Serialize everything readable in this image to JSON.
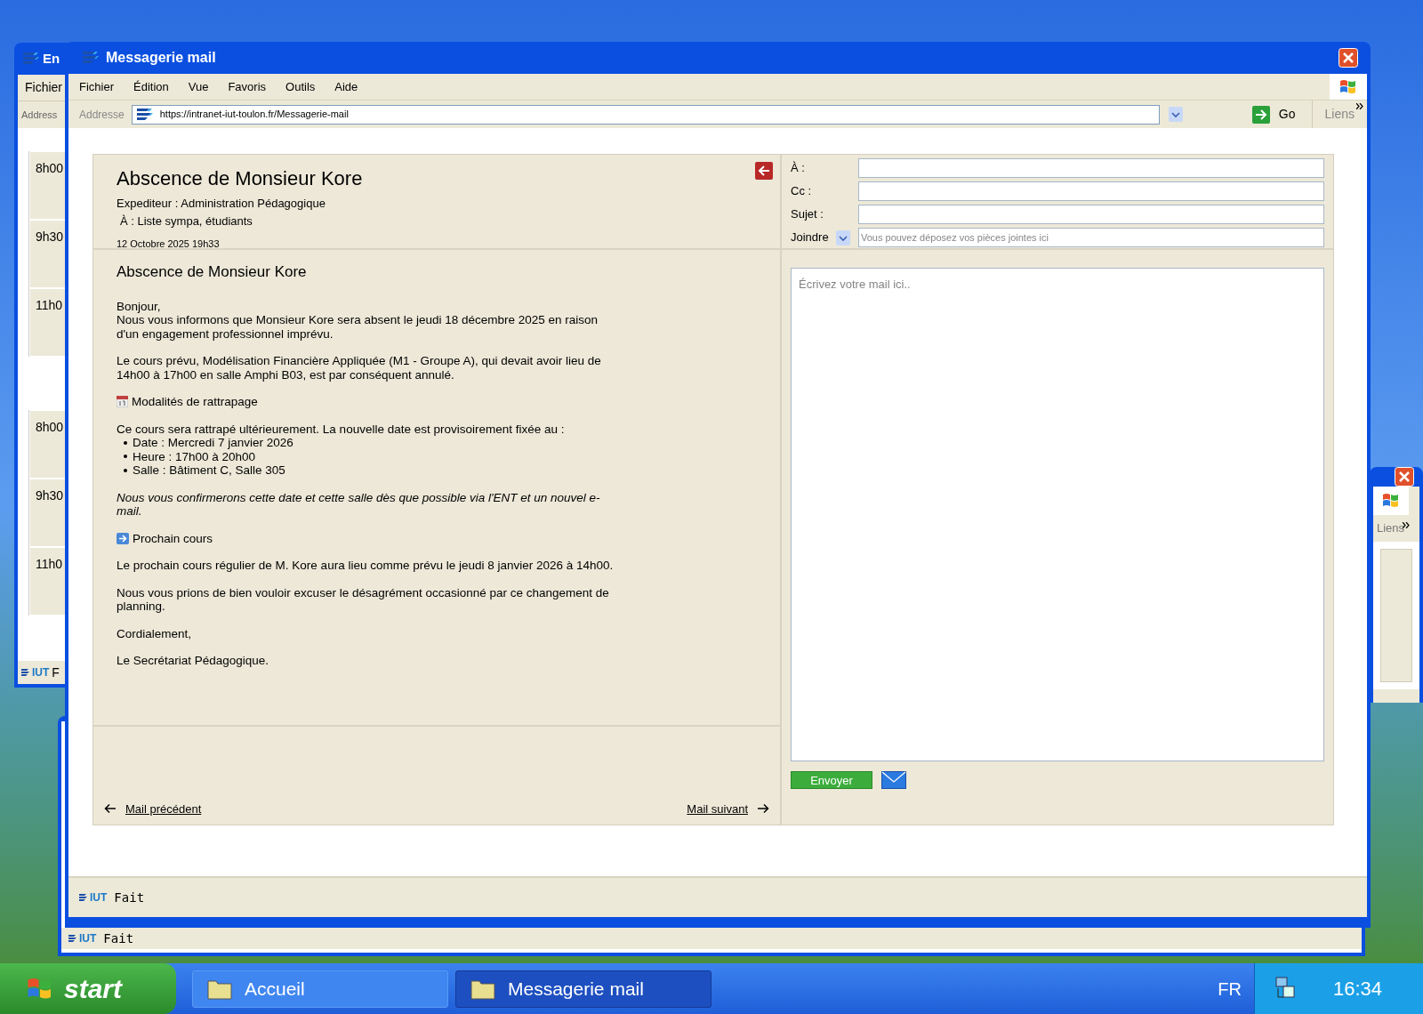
{
  "left_window": {
    "title": "En",
    "menu": [
      "Fichier"
    ],
    "address_label": "Address",
    "schedule_groups": [
      [
        "8h00",
        "9h30",
        "11h0"
      ],
      [
        "8h00",
        "9h30",
        "11h0"
      ]
    ],
    "status_logo": "IUT",
    "status": "F"
  },
  "right_window": {
    "links": "Liens"
  },
  "bottom_window": {
    "status_logo": "IUT",
    "status": "Fait"
  },
  "window": {
    "title": "Messagerie mail",
    "menu": [
      "Fichier",
      "Édition",
      "Vue",
      "Favoris",
      "Outils",
      "Aide"
    ],
    "address_label": "Addresse",
    "url": "https://intranet-iut-toulon.fr/Messagerie-mail",
    "go": "Go",
    "links": "Liens",
    "mail": {
      "subject": "Abscence de Monsieur Kore",
      "sender": "Expediteur : Administration Pédagogique",
      "recipients": "À : Liste sympa, étudiants",
      "date": "12 Octobre 2025 19h33",
      "body_title": "Abscence de Monsieur Kore",
      "body": [
        {
          "kind": "paragraph",
          "text": "Bonjour,\nNous vous informons que Monsieur Kore sera absent le jeudi 18 décembre 2025 en raison d'un engagement professionnel imprévu."
        },
        {
          "kind": "paragraph",
          "text": "Le cours prévu, Modélisation Financière Appliquée (M1 - Groupe A), qui devait avoir lieu de 14h00 à 17h00 en salle Amphi B03, est par conséquent annulé."
        },
        {
          "kind": "calendar_heading",
          "text": "Modalités de rattrapage"
        },
        {
          "kind": "list",
          "text": "Ce cours sera rattrapé ultérieurement. La nouvelle date est provisoirement fixée au :",
          "items": [
            "Date : Mercredi 7 janvier 2026",
            "Heure : 17h00 à 20h00",
            "Salle : Bâtiment C, Salle 305"
          ]
        },
        {
          "kind": "note",
          "text": "Nous vous confirmerons cette date et cette salle dès que possible via l'ENT et un nouvel e-mail."
        },
        {
          "kind": "arrow_heading",
          "text": "Prochain cours"
        },
        {
          "kind": "paragraph",
          "text": "Le prochain cours régulier de M. Kore aura lieu comme prévu le jeudi 8 janvier 2026 à 14h00."
        },
        {
          "kind": "paragraph",
          "text": "Nous vous prions de bien vouloir excuser le désagrément occasionné par ce changement de planning."
        },
        {
          "kind": "paragraph",
          "text": "Cordialement,"
        },
        {
          "kind": "paragraph",
          "text": "Le Secrétariat Pédagogique."
        }
      ],
      "previous": "Mail précédent",
      "next": "Mail suivant"
    },
    "compose": {
      "fields": [
        {
          "kind": "text",
          "label": "À :"
        },
        {
          "kind": "text",
          "label": "Cc :"
        },
        {
          "kind": "text",
          "label": "Sujet :"
        },
        {
          "kind": "attach",
          "label": "Joindre",
          "placeholder": "Vous pouvez déposez vos pièces jointes ici"
        }
      ],
      "message_placeholder": "Écrivez votre mail ici..",
      "send": "Envoyer"
    },
    "status_logo": "IUT",
    "status": "Fait"
  },
  "taskbar": {
    "start": "start",
    "tasks": [
      {
        "label": "Accueil",
        "selected": false
      },
      {
        "label": "Messagerie mail",
        "selected": true
      }
    ],
    "language": "FR",
    "clock": "16:34"
  }
}
